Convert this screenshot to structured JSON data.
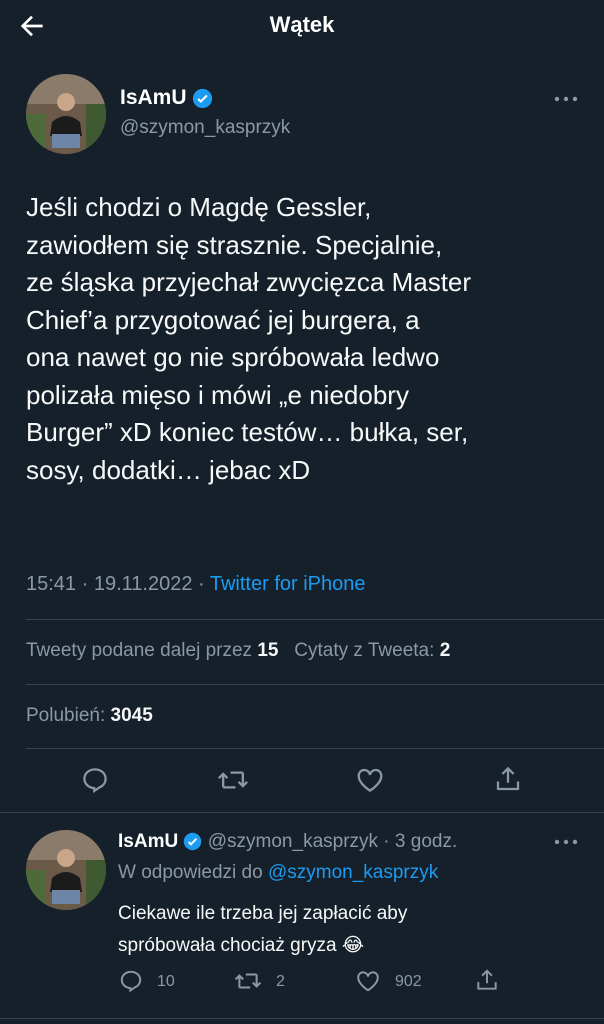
{
  "header": {
    "title": "Wątek"
  },
  "tweet": {
    "display_name": "IsAmU",
    "handle": "@szymon_kasprzyk",
    "lines": [
      "Jeśli chodzi o Magdę Gessler,",
      "zawiodłem się strasznie. Specjalnie,",
      "ze śląska przyjechał zwycięzca Master",
      "Chief’a przygotować jej burgera, a",
      "ona nawet go nie spróbowała ledwo",
      "polizała mięso i mówi „e niedobry",
      "Burger” xD koniec testów… bułka, ser,",
      "sosy, dodatki… jebac xD"
    ],
    "time": "15:41 · 19.11.2022 · ",
    "source": "Twitter for iPhone",
    "retweets_label": "Tweety podane dalej przez ",
    "retweets_count": "15",
    "quotes_label": "Cytaty z Tweeta: ",
    "quotes_count": "2",
    "likes_label": "Polubień: ",
    "likes_count": "3045"
  },
  "reply": {
    "display_name": "IsAmU",
    "handle_time": "@szymon_kasprzyk · 3 godz.",
    "in_reply_to_label": "W odpowiedzi do ",
    "in_reply_to_handle": "@szymon_kasprzyk",
    "text_line1": "Ciekawe ile trzeba jej zapłacić aby",
    "text_line2": "spróbowała chociaż gryza",
    "emoji": "😂",
    "replies_count": "10",
    "retweets_count": "2",
    "likes_count": "902"
  },
  "colors": {
    "background": "#15202b",
    "accent": "#1d9bf0",
    "muted": "#8b98a5",
    "divider": "#38444d"
  },
  "icons": [
    "back-arrow-icon",
    "verified-badge-icon",
    "more-icon",
    "reply-icon",
    "retweet-icon",
    "like-icon",
    "share-icon"
  ]
}
